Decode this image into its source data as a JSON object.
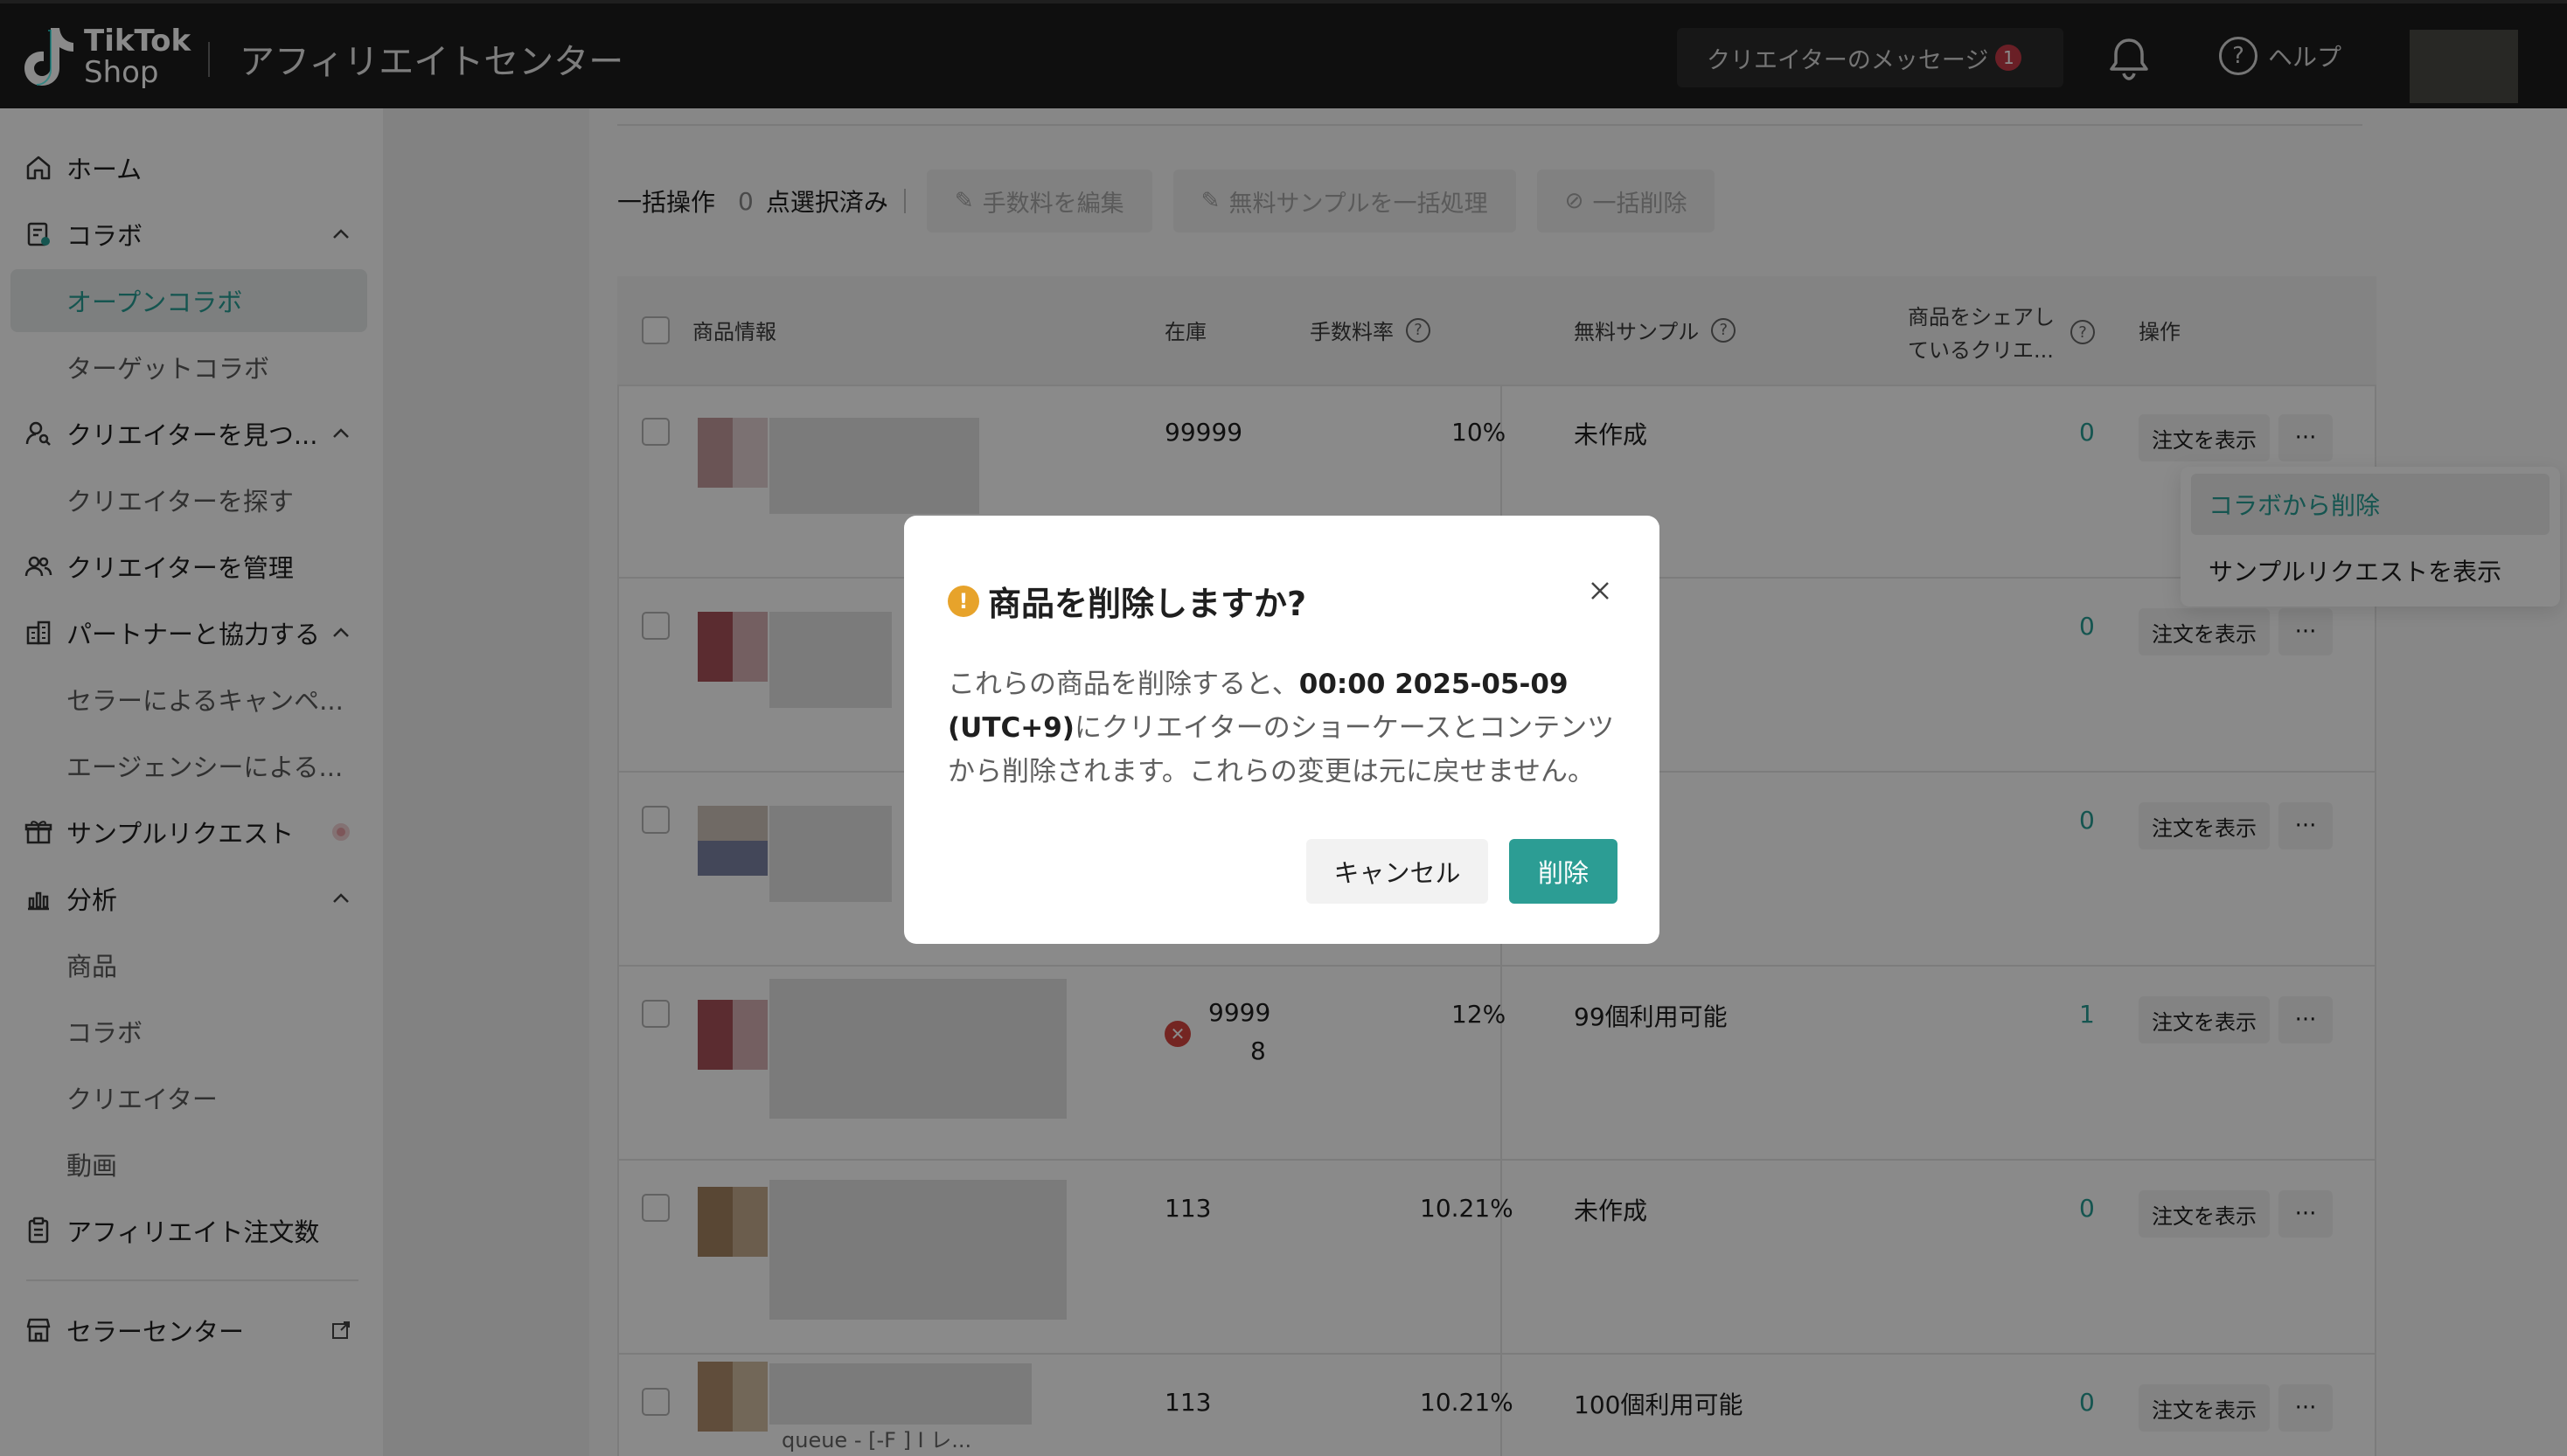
{
  "header": {
    "brand_line1": "TikTok",
    "brand_line2": "Shop",
    "app_title": "アフィリエイトセンター",
    "creator_messages": "クリエイターのメッセージ",
    "message_badge": "1",
    "help": "ヘルプ"
  },
  "sidebar": {
    "home": "ホーム",
    "collab": "コラボ",
    "open_collab": "オープンコラボ",
    "target_collab": "ターゲットコラボ",
    "find_creators_group": "クリエイターを見つ...",
    "find_creators": "クリエイターを探す",
    "manage_creators": "クリエイターを管理",
    "partners": "パートナーと協力する",
    "seller_campaigns": "セラーによるキャンペ...",
    "agency": "エージェンシーによる...",
    "sample_requests": "サンプルリクエスト",
    "analytics": "分析",
    "analytics_products": "商品",
    "analytics_collab": "コラボ",
    "analytics_creators": "クリエイター",
    "analytics_videos": "動画",
    "affiliate_orders": "アフィリエイト注文数",
    "seller_center": "セラーセンター"
  },
  "bulk": {
    "label": "一括操作",
    "selected_count": "0",
    "selected_label": "点選択済み",
    "edit_commission": "手数料を編集",
    "free_samples": "無料サンプルを一括処理",
    "bulk_delete": "一括削除"
  },
  "table": {
    "headers": {
      "product": "商品情報",
      "stock": "在庫",
      "commission": "手数料率",
      "free_sample": "無料サンプル",
      "sharing_line1": "商品をシェアし",
      "sharing_line2": "ているクリエ...",
      "actions": "操作"
    },
    "view_orders": "注文を表示",
    "more": "···",
    "rows": [
      {
        "stock": "99999",
        "commission": "10%",
        "sample": "未作成",
        "creators": "0"
      },
      {
        "stock": "",
        "commission": "",
        "sample": "",
        "creators": "0"
      },
      {
        "stock": "",
        "commission": "",
        "sample": "",
        "creators": "0"
      },
      {
        "stock_line1": "9999",
        "stock_line2": "8",
        "commission": "12%",
        "sample": "99個利用可能",
        "creators": "1"
      },
      {
        "stock": "113",
        "commission": "10.21%",
        "sample": "未作成",
        "creators": "0"
      },
      {
        "stock": "113",
        "commission": "10.21%",
        "sample": "100個利用可能",
        "creators": "0",
        "product_snippet": "queue - [-F ] I レ..."
      }
    ]
  },
  "dropdown": {
    "remove_from_collab": "コラボから削除",
    "view_sample_requests": "サンプルリクエストを表示"
  },
  "modal": {
    "title": "商品を削除しますか?",
    "body_pre": "これらの商品を削除すると、",
    "body_time": "00:00 2025-05-09 (UTC+9)",
    "body_post": "にクリエイターのショーケースとコンテンツから削除されます。これらの変更は元に戻せません。",
    "cancel": "キャンセル",
    "delete": "削除"
  },
  "colors": {
    "accent": "#2c9d94",
    "warning": "#e7a32b",
    "error": "#d6453f",
    "badge": "#c53a47"
  }
}
